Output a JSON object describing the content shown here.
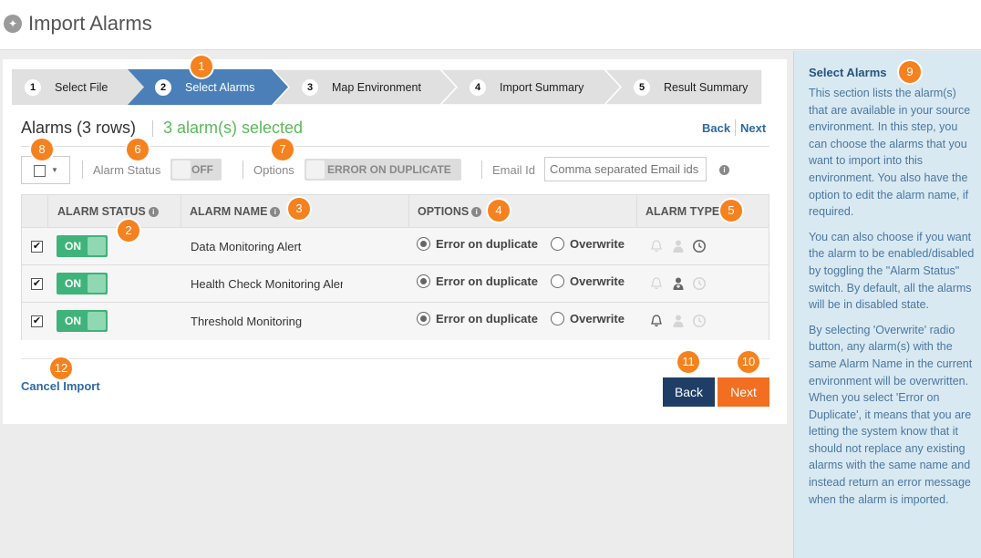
{
  "header": {
    "title": "Import Alarms",
    "icon": "pin-icon"
  },
  "wizard": {
    "steps": [
      {
        "num": "1",
        "label": "Select File"
      },
      {
        "num": "2",
        "label": "Select Alarms"
      },
      {
        "num": "3",
        "label": "Map Environment"
      },
      {
        "num": "4",
        "label": "Import Summary"
      },
      {
        "num": "5",
        "label": "Result Summary"
      }
    ],
    "active_step": 2,
    "colors": {
      "active": "#4a7fb8",
      "inactive": "#e0e0e0"
    }
  },
  "alarms": {
    "title": "Alarms (3 rows)",
    "selected": "3 alarm(s) selected",
    "back_link": "Back",
    "next_link": "Next"
  },
  "toolbar": {
    "alarm_status_label": "Alarm Status",
    "alarm_status_value": "OFF",
    "options_label": "Options",
    "options_value": "ERROR ON DUPLICATE",
    "email_label": "Email Id",
    "email_placeholder": "Comma separated Email ids"
  },
  "table": {
    "headers": [
      "ALARM STATUS",
      "ALARM NAME",
      "OPTIONS",
      "ALARM TYPE"
    ],
    "rows": [
      {
        "checked": "✔",
        "status": "ON",
        "name": "Data Monitoring Alert",
        "option": "Error on duplicate",
        "alt_option": "Overwrite",
        "active_type": "clock-icon"
      },
      {
        "checked": "✔",
        "status": "ON",
        "name": "Health Check Monitoring Alert",
        "option": "Error on duplicate",
        "alt_option": "Overwrite",
        "active_type": "doctor-icon"
      },
      {
        "checked": "✔",
        "status": "ON",
        "name": "Threshold Monitoring",
        "option": "Error on duplicate",
        "alt_option": "Overwrite",
        "active_type": "bell-icon"
      }
    ]
  },
  "footer": {
    "cancel": "Cancel Import",
    "back": "Back",
    "next": "Next"
  },
  "badges": [
    "1",
    "2",
    "3",
    "4",
    "5",
    "6",
    "7",
    "8",
    "9",
    "10",
    "11",
    "12"
  ],
  "help": {
    "title": "Select Alarms",
    "paragraphs": [
      "This section lists the alarm(s) that are available in your source environment. In this step, you can choose the alarms that you want to import into this environment. You also have the option to edit the alarm name, if required.",
      "You can also choose if you want the alarm to be enabled/disabled by toggling the \"Alarm Status\" switch. By default, all the alarms will be in disabled state.",
      "By selecting 'Overwrite' radio button, any alarm(s) with the same Alarm Name in the current environment will be overwritten. When you select 'Error on Duplicate', it means that you are letting the system know that it should not replace any existing alarms with the same name and instead return an error message when the alarm is imported."
    ]
  },
  "colors": {
    "accent": "#f5821f",
    "link": "#2d6aa0",
    "success": "#3fb37a",
    "back_btn": "#1f3e66",
    "next_btn": "#f26f21"
  }
}
